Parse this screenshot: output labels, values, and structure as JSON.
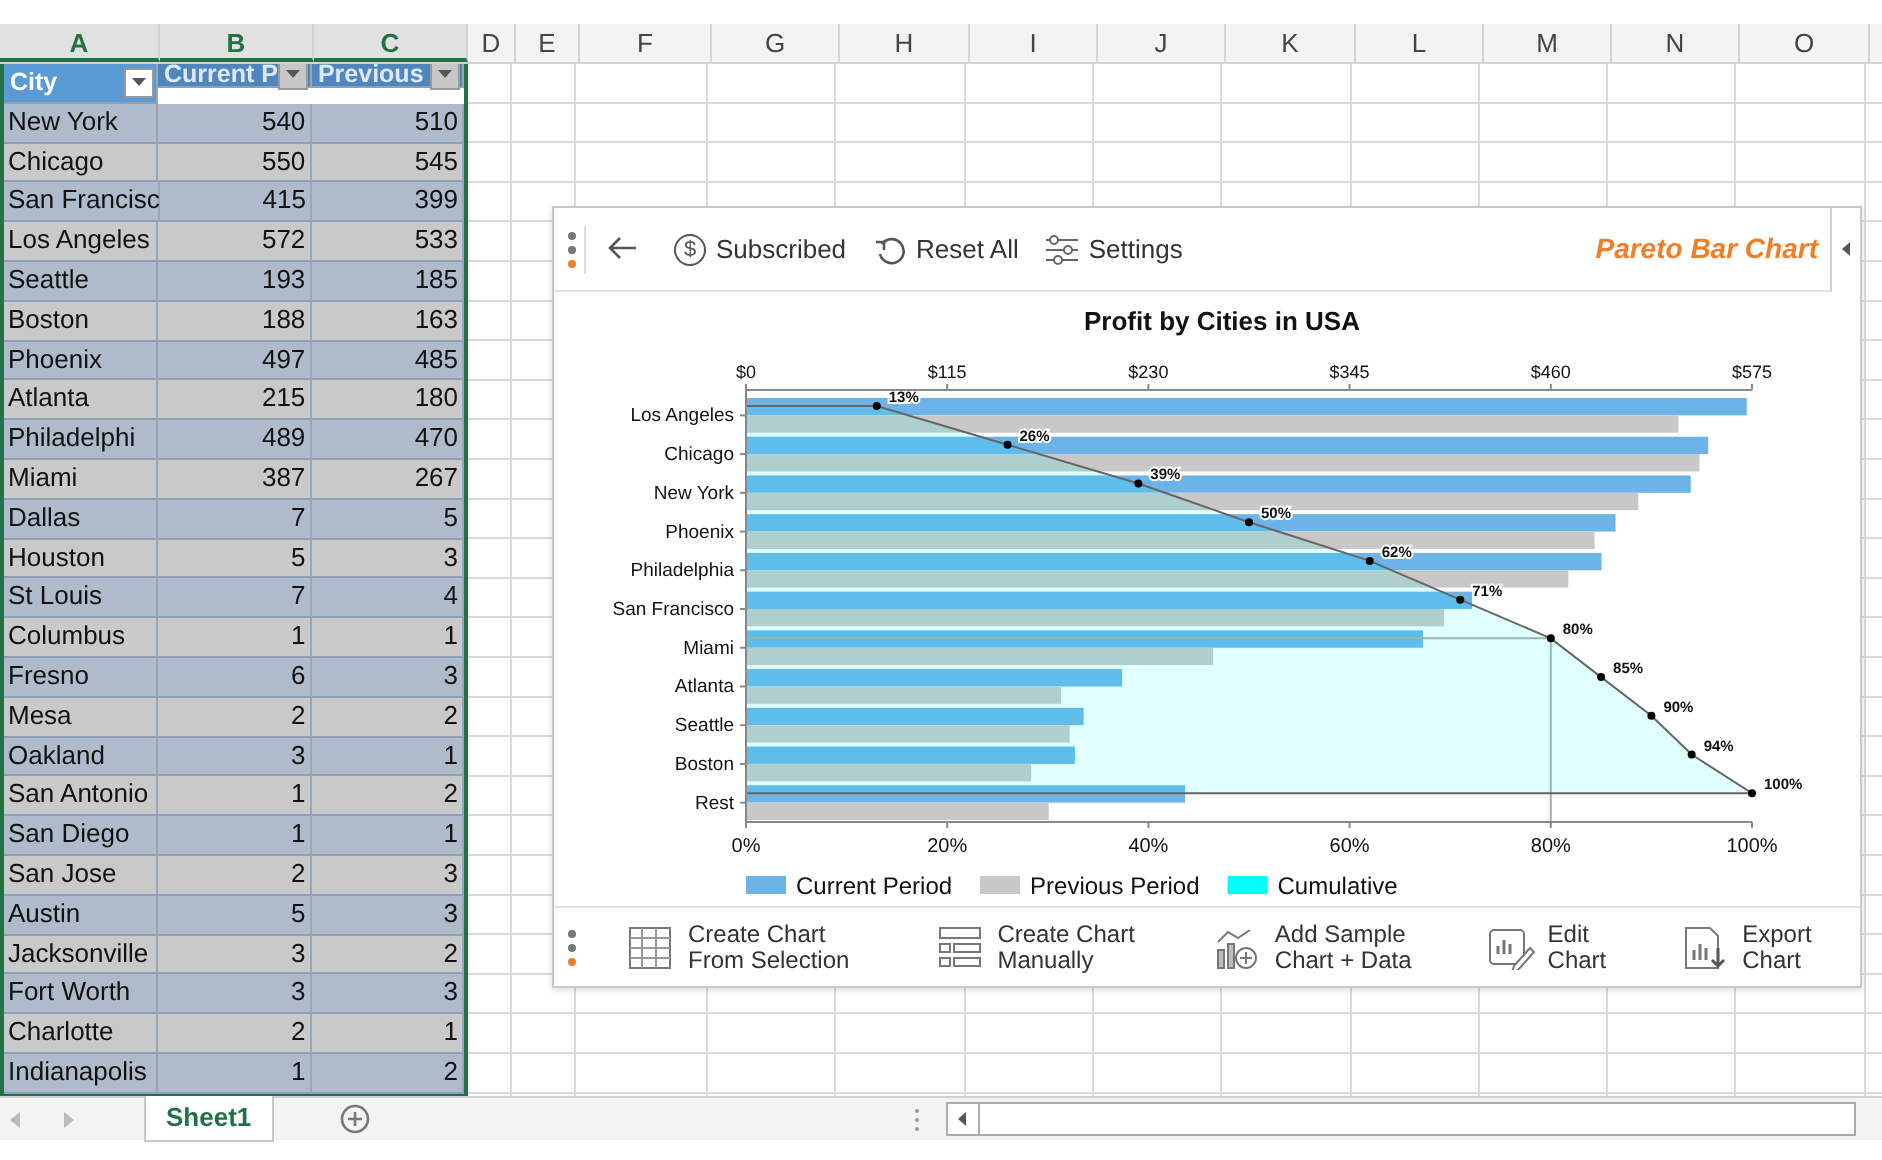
{
  "sheet": {
    "columns": [
      {
        "label": "A",
        "selected": true
      },
      {
        "label": "B",
        "selected": true
      },
      {
        "label": "C",
        "selected": true
      },
      {
        "label": "D",
        "selected": false
      },
      {
        "label": "E",
        "selected": false
      },
      {
        "label": "F",
        "selected": false
      },
      {
        "label": "G",
        "selected": false
      },
      {
        "label": "H",
        "selected": false
      },
      {
        "label": "I",
        "selected": false
      },
      {
        "label": "J",
        "selected": false
      },
      {
        "label": "K",
        "selected": false
      },
      {
        "label": "L",
        "selected": false
      },
      {
        "label": "M",
        "selected": false
      },
      {
        "label": "N",
        "selected": false
      },
      {
        "label": "O",
        "selected": false
      }
    ],
    "table": {
      "headers": [
        {
          "label": "City",
          "active": true
        },
        {
          "label": "Current P",
          "active": false
        },
        {
          "label": "Previous",
          "active": false
        }
      ],
      "rows": [
        [
          "New York",
          "540",
          "510"
        ],
        [
          "Chicago",
          "550",
          "545"
        ],
        [
          "San Francisc",
          "415",
          "399"
        ],
        [
          "Los Angeles",
          "572",
          "533"
        ],
        [
          "Seattle",
          "193",
          "185"
        ],
        [
          "Boston",
          "188",
          "163"
        ],
        [
          "Phoenix",
          "497",
          "485"
        ],
        [
          "Atlanta",
          "215",
          "180"
        ],
        [
          "Philadelphi",
          "489",
          "470"
        ],
        [
          "Miami",
          "387",
          "267"
        ],
        [
          "Dallas",
          "7",
          "5"
        ],
        [
          "Houston",
          "5",
          "3"
        ],
        [
          "St Louis",
          "7",
          "4"
        ],
        [
          "Columbus",
          "1",
          "1"
        ],
        [
          "Fresno",
          "6",
          "3"
        ],
        [
          "Mesa",
          "2",
          "2"
        ],
        [
          "Oakland",
          "3",
          "1"
        ],
        [
          "San Antonio",
          "1",
          "2"
        ],
        [
          "San Diego",
          "1",
          "1"
        ],
        [
          "San Jose",
          "2",
          "3"
        ],
        [
          "Austin",
          "5",
          "3"
        ],
        [
          "Jacksonville",
          "3",
          "2"
        ],
        [
          "Fort Worth",
          "3",
          "3"
        ],
        [
          "Charlotte",
          "2",
          "1"
        ],
        [
          "Indianapolis",
          "1",
          "2"
        ]
      ]
    },
    "tabs": [
      {
        "label": "Sheet1",
        "selected": true
      }
    ]
  },
  "panel": {
    "toolbar": [
      {
        "kind": "back"
      },
      {
        "kind": "subscribed",
        "symbol": "$",
        "label": "Subscribed"
      },
      {
        "kind": "reset",
        "label": "Reset All"
      },
      {
        "kind": "settings",
        "label": "Settings"
      }
    ],
    "title": "Pareto Bar Chart",
    "chart_data": {
      "type": "bar",
      "orientation": "horizontal",
      "title": "Profit by Cities in USA",
      "categories": [
        "Los Angeles",
        "Chicago",
        "New York",
        "Phoenix",
        "Philadelphia",
        "San Francisco",
        "Miami",
        "Atlanta",
        "Seattle",
        "Boston",
        "Rest"
      ],
      "series": [
        {
          "name": "Current Period",
          "color": "#6cb4e8",
          "type": "bar",
          "values": [
            572,
            550,
            540,
            497,
            489,
            415,
            387,
            215,
            193,
            188,
            251
          ]
        },
        {
          "name": "Previous Period",
          "color": "#c8c8c8",
          "type": "bar",
          "values": [
            533,
            545,
            510,
            485,
            470,
            399,
            267,
            180,
            185,
            163,
            173
          ]
        },
        {
          "name": "Cumulative",
          "color": "#00ffff",
          "type": "area",
          "axis": "x2",
          "values": [
            13,
            26,
            39,
            50,
            62,
            71,
            80,
            85,
            90,
            94,
            100
          ],
          "value_labels": [
            "13%",
            "26%",
            "39%",
            "50%",
            "62%",
            "71%",
            "80%",
            "85%",
            "90%",
            "94%",
            "100%"
          ]
        }
      ],
      "xlim": [
        0,
        575
      ],
      "xticks": [
        {
          "value": 0,
          "label": "$0"
        },
        {
          "value": 115,
          "label": "$115"
        },
        {
          "value": 230,
          "label": "$230"
        },
        {
          "value": 345,
          "label": "$345"
        },
        {
          "value": 460,
          "label": "$460"
        },
        {
          "value": 575,
          "label": "$575"
        }
      ],
      "x2lim": [
        0,
        100
      ],
      "x2ticks": [
        {
          "value": 0,
          "label": "0%"
        },
        {
          "value": 20,
          "label": "20%"
        },
        {
          "value": 40,
          "label": "40%"
        },
        {
          "value": 60,
          "label": "60%"
        },
        {
          "value": 80,
          "label": "80%"
        },
        {
          "value": 100,
          "label": "100%"
        }
      ],
      "ref_lines": [
        {
          "axis": "x2",
          "value": 80
        }
      ],
      "legend": "bottom"
    },
    "actions": [
      {
        "kind": "from_selection",
        "lines": [
          "Create Chart",
          "From Selection"
        ]
      },
      {
        "kind": "manual",
        "lines": [
          "Create Chart",
          "Manually"
        ]
      },
      {
        "kind": "sample",
        "lines": [
          "Add Sample",
          "Chart + Data"
        ]
      },
      {
        "kind": "edit",
        "lines": [
          "Edit",
          "Chart"
        ]
      },
      {
        "kind": "export",
        "lines": [
          "Export",
          "Chart"
        ]
      }
    ]
  }
}
